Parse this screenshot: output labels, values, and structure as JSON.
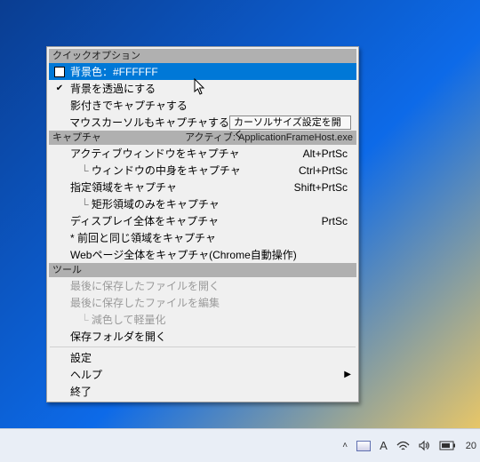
{
  "sections": {
    "quick": {
      "label": "クイックオプション"
    },
    "capture": {
      "label": "キャプチャ",
      "right": "アクティブ: ApplicationFrameHost.exe"
    },
    "tools": {
      "label": "ツール"
    }
  },
  "quick": {
    "bgcolor_label": "背景色：#FFFFFF",
    "bgcolor_value": "#FFFFFF",
    "transparent": "背景を透過にする",
    "shadow": "影付きでキャプチャする",
    "mouse": "マウスカーソルもキャプチャする",
    "cursor_size_btn": "カーソルサイズ設定を開く"
  },
  "capture": {
    "active_window": {
      "label": "アクティブウィンドウをキャプチャ",
      "shortcut": "Alt+PrtSc"
    },
    "window_content": {
      "label": "ウィンドウの中身をキャプチャ",
      "shortcut": "Ctrl+PrtSc"
    },
    "region": {
      "label": "指定領域をキャプチャ",
      "shortcut": "Shift+PrtSc"
    },
    "rect_only": {
      "label": "矩形領域のみをキャプチャ"
    },
    "fullscreen": {
      "label": "ディスプレイ全体をキャプチャ",
      "shortcut": "PrtSc"
    },
    "same_region": {
      "label": "* 前回と同じ領域をキャプチャ"
    },
    "webpage": {
      "label": "Webページ全体をキャプチャ(Chrome自動操作)"
    }
  },
  "tools": {
    "open_last": "最後に保存したファイルを開く",
    "edit_last": "最後に保存したファイルを編集",
    "reduce": "減色して軽量化",
    "open_folder": "保存フォルダを開く"
  },
  "footer": {
    "settings": "設定",
    "help": "ヘルプ",
    "exit": "終了"
  },
  "tray": {
    "ime": "A",
    "clock": "20"
  }
}
